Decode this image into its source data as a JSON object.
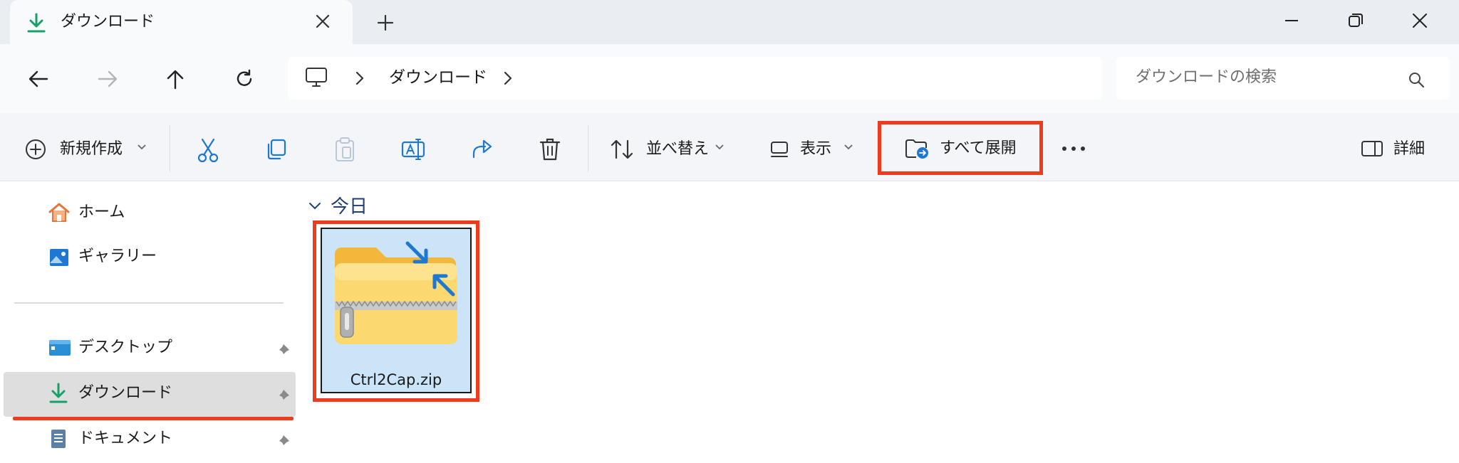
{
  "tab": {
    "title": "ダウンロード",
    "icon": "download-icon"
  },
  "window_controls": [
    "minimize-icon",
    "maximize-icon",
    "close-icon"
  ],
  "address": {
    "breadcrumb": "ダウンロード",
    "root_icon": "this-pc-icon"
  },
  "search": {
    "placeholder": "ダウンロードの検索"
  },
  "toolbar": {
    "new_label": "新規作成",
    "sort_label": "並べ替え",
    "view_label": "表示",
    "extract_label": "すべて展開",
    "details_label": "詳細"
  },
  "sidebar": {
    "items": [
      {
        "label": "ホーム",
        "icon": "home-icon"
      },
      {
        "label": "ギャラリー",
        "icon": "gallery-icon"
      },
      {
        "label": "デスクトップ",
        "icon": "desktop-icon"
      },
      {
        "label": "ダウンロード",
        "icon": "download-icon"
      },
      {
        "label": "ドキュメント",
        "icon": "document-icon"
      }
    ]
  },
  "content": {
    "group_label": "今日",
    "files": [
      {
        "name": "Ctrl2Cap.zip",
        "icon": "zip-folder-icon"
      }
    ]
  },
  "colors": {
    "highlight": "#f03a1d",
    "selection": "#cce4f7",
    "download_green": "#16a06a",
    "accent_blue": "#1e78d2"
  }
}
